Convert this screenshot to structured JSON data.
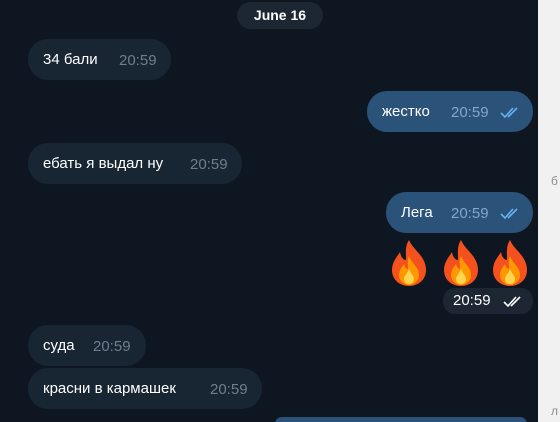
{
  "date_label": "June 16",
  "messages": [
    {
      "text": "34 бали",
      "time": "20:59",
      "direction": "in"
    },
    {
      "text": "жестко",
      "time": "20:59",
      "direction": "out",
      "status": "read"
    },
    {
      "text": "ебать я выдал ну",
      "time": "20:59",
      "direction": "in"
    },
    {
      "text": "Лега",
      "time": "20:59",
      "direction": "out",
      "status": "read"
    },
    {
      "text": "суда",
      "time": "20:59",
      "direction": "in"
    },
    {
      "text": "красни в кармашек",
      "time": "20:59",
      "direction": "in"
    }
  ],
  "sticker": {
    "emoji": [
      "fire-emoji",
      "fire-emoji",
      "fire-emoji"
    ],
    "time": "20:59",
    "status": "read"
  },
  "side_strip": {
    "glyph_top": "б",
    "glyph_bottom": "л"
  },
  "colors": {
    "background": "#0e1621",
    "incoming_bubble": "#182533",
    "outgoing_bubble": "#2b5278",
    "read_ticks_outgoing": "#63b3f2",
    "read_ticks_sticker": "#ffffff"
  }
}
